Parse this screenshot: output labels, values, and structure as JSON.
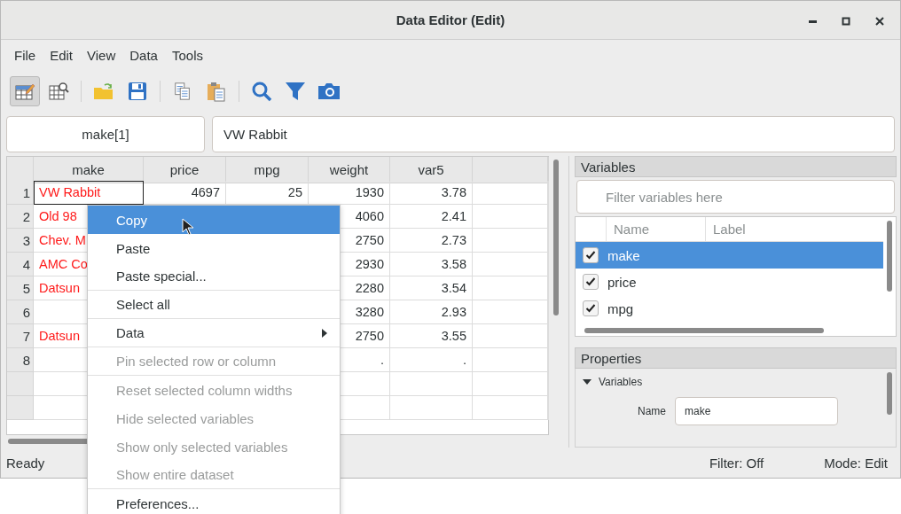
{
  "window": {
    "title": "Data Editor (Edit)"
  },
  "menu_bar": [
    "File",
    "Edit",
    "View",
    "Data",
    "Tools"
  ],
  "toolbar": [
    {
      "selected": true
    },
    {
      "selected": false
    },
    {
      "selected": false
    },
    {
      "selected": false
    },
    {
      "selected": false
    },
    {
      "selected": false
    },
    {
      "selected": false
    },
    {
      "selected": false
    },
    {
      "selected": false
    }
  ],
  "cell_editor": {
    "reference": "make[1]",
    "value": "VW Rabbit"
  },
  "table": {
    "columns": [
      {
        "label": "make",
        "kind": "string"
      },
      {
        "label": "price",
        "kind": "number"
      },
      {
        "label": "mpg",
        "kind": "number"
      },
      {
        "label": "weight",
        "kind": "number"
      },
      {
        "label": "var5",
        "kind": "number"
      }
    ],
    "rows": [
      {
        "number": "1",
        "selected": true,
        "cells": [
          "VW Rabbit",
          "4697",
          "25",
          "1930",
          "3.78"
        ]
      },
      {
        "number": "2",
        "selected": false,
        "cells": [
          "Old 98",
          "",
          "",
          "4060",
          "2.41"
        ]
      },
      {
        "number": "3",
        "selected": false,
        "cells": [
          "Chev. M",
          "",
          "",
          "2750",
          "2.73"
        ]
      },
      {
        "number": "4",
        "selected": false,
        "cells": [
          "AMC Co",
          "",
          "",
          "2930",
          "3.58"
        ]
      },
      {
        "number": "5",
        "selected": false,
        "cells": [
          "Datsun",
          "",
          "",
          "2280",
          "3.54"
        ]
      },
      {
        "number": "6",
        "selected": false,
        "cells": [
          "",
          "",
          "",
          "3280",
          "2.93"
        ]
      },
      {
        "number": "7",
        "selected": false,
        "cells": [
          "Datsun",
          "",
          "",
          "2750",
          "3.55"
        ]
      },
      {
        "number": "8",
        "selected": false,
        "cells": [
          "",
          "",
          "",
          ".",
          "."
        ]
      }
    ]
  },
  "variables_panel": {
    "title": "Variables",
    "filter_placeholder": "Filter variables here",
    "columns": [
      "Name",
      "Label"
    ],
    "items": [
      {
        "name": "make",
        "checked": true,
        "selected": true
      },
      {
        "name": "price",
        "checked": true,
        "selected": false
      },
      {
        "name": "mpg",
        "checked": true,
        "selected": false
      }
    ]
  },
  "properties_panel": {
    "title": "Properties",
    "section": {
      "label": "Variables",
      "expanded": true
    },
    "fields": [
      {
        "label": "Name",
        "value": "make"
      }
    ]
  },
  "status_bar": {
    "status": "Ready",
    "filter": "Filter: Off",
    "mode": "Mode: Edit"
  },
  "context_menu": {
    "items": [
      {
        "label": "Copy",
        "selected": true,
        "disabled": false,
        "submenu": false,
        "separator_after": false
      },
      {
        "label": "Paste",
        "selected": false,
        "disabled": false,
        "submenu": false,
        "separator_after": false
      },
      {
        "label": "Paste special...",
        "selected": false,
        "disabled": false,
        "submenu": false,
        "separator_after": true
      },
      {
        "label": "Select all",
        "selected": false,
        "disabled": false,
        "submenu": false,
        "separator_after": true
      },
      {
        "label": "Data",
        "selected": false,
        "disabled": false,
        "submenu": true,
        "separator_after": true
      },
      {
        "label": "Pin selected row or column",
        "selected": false,
        "disabled": true,
        "submenu": false,
        "separator_after": true
      },
      {
        "label": "Reset selected column widths",
        "selected": false,
        "disabled": true,
        "submenu": false,
        "separator_after": false
      },
      {
        "label": "Hide selected variables",
        "selected": false,
        "disabled": true,
        "submenu": false,
        "separator_after": false
      },
      {
        "label": "Show only selected variables",
        "selected": false,
        "disabled": true,
        "submenu": false,
        "separator_after": false
      },
      {
        "label": "Show entire dataset",
        "selected": false,
        "disabled": true,
        "submenu": false,
        "separator_after": true
      },
      {
        "label": "Preferences...",
        "selected": false,
        "disabled": false,
        "submenu": false,
        "separator_after": false
      }
    ]
  }
}
